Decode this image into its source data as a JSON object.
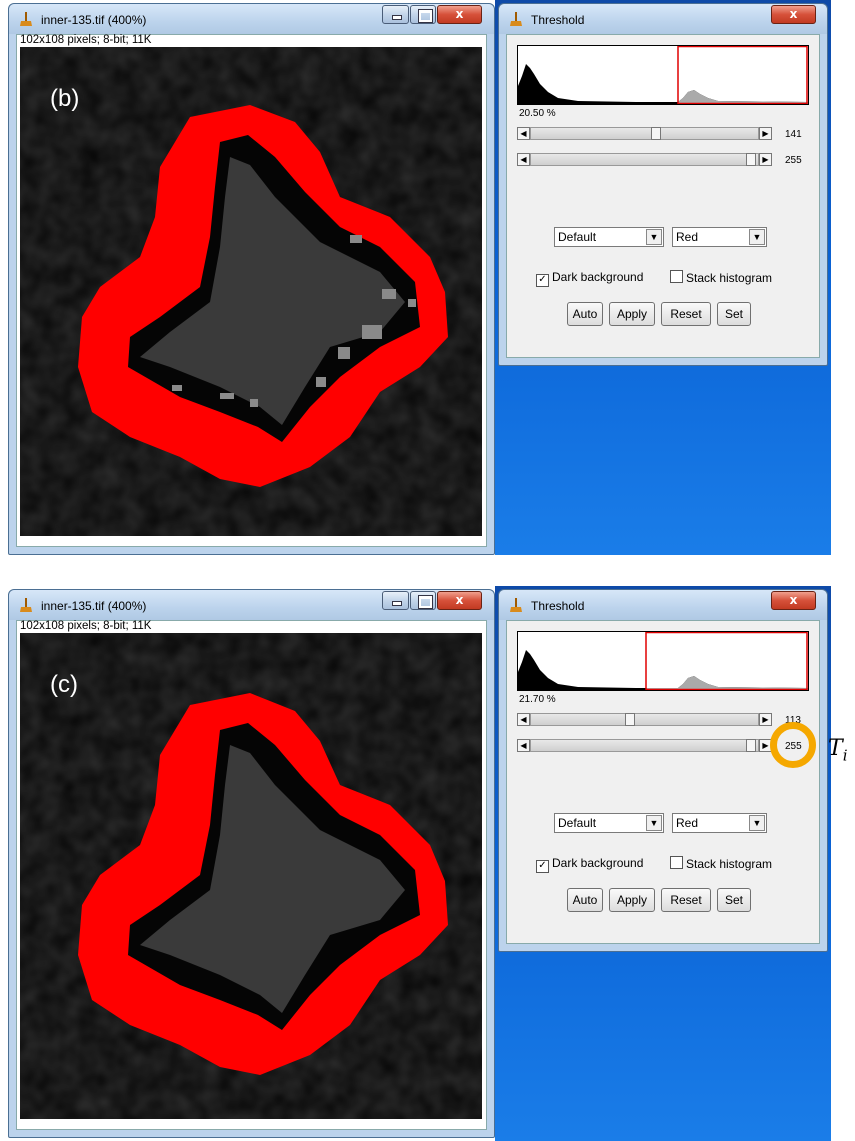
{
  "panels": [
    {
      "image_window": {
        "title": "inner-135.tif (400%)",
        "info": "102x108 pixels; 8-bit; 11K",
        "panel_label": "(b)"
      },
      "threshold_window": {
        "title": "Threshold",
        "percent": "20.50 %",
        "lower_value": "141",
        "upper_value": "255",
        "lower_fraction": 0.553,
        "method": "Default",
        "display": "Red",
        "dark_background_label": "Dark background",
        "dark_background_checked": true,
        "stack_histogram_label": "Stack histogram",
        "stack_histogram_checked": false,
        "buttons": [
          "Auto",
          "Apply",
          "Reset",
          "Set"
        ]
      },
      "gray_pixels_visible": true
    },
    {
      "image_window": {
        "title": "inner-135.tif (400%)",
        "info": "102x108 pixels; 8-bit; 11K",
        "panel_label": "(c)"
      },
      "threshold_window": {
        "title": "Threshold",
        "percent": "21.70 %",
        "lower_value": "113",
        "upper_value": "255",
        "lower_fraction": 0.443,
        "method": "Default",
        "display": "Red",
        "dark_background_label": "Dark background",
        "dark_background_checked": true,
        "stack_histogram_label": "Stack histogram",
        "stack_histogram_checked": false,
        "buttons": [
          "Auto",
          "Apply",
          "Reset",
          "Set"
        ]
      },
      "gray_pixels_visible": false,
      "annotation_label": "T",
      "annotation_subscript": "i"
    }
  ],
  "colors": {
    "threshold_red": "#ff0000",
    "highlight_ring": "#f5a800",
    "desktop_blue": "#0a63d6"
  }
}
